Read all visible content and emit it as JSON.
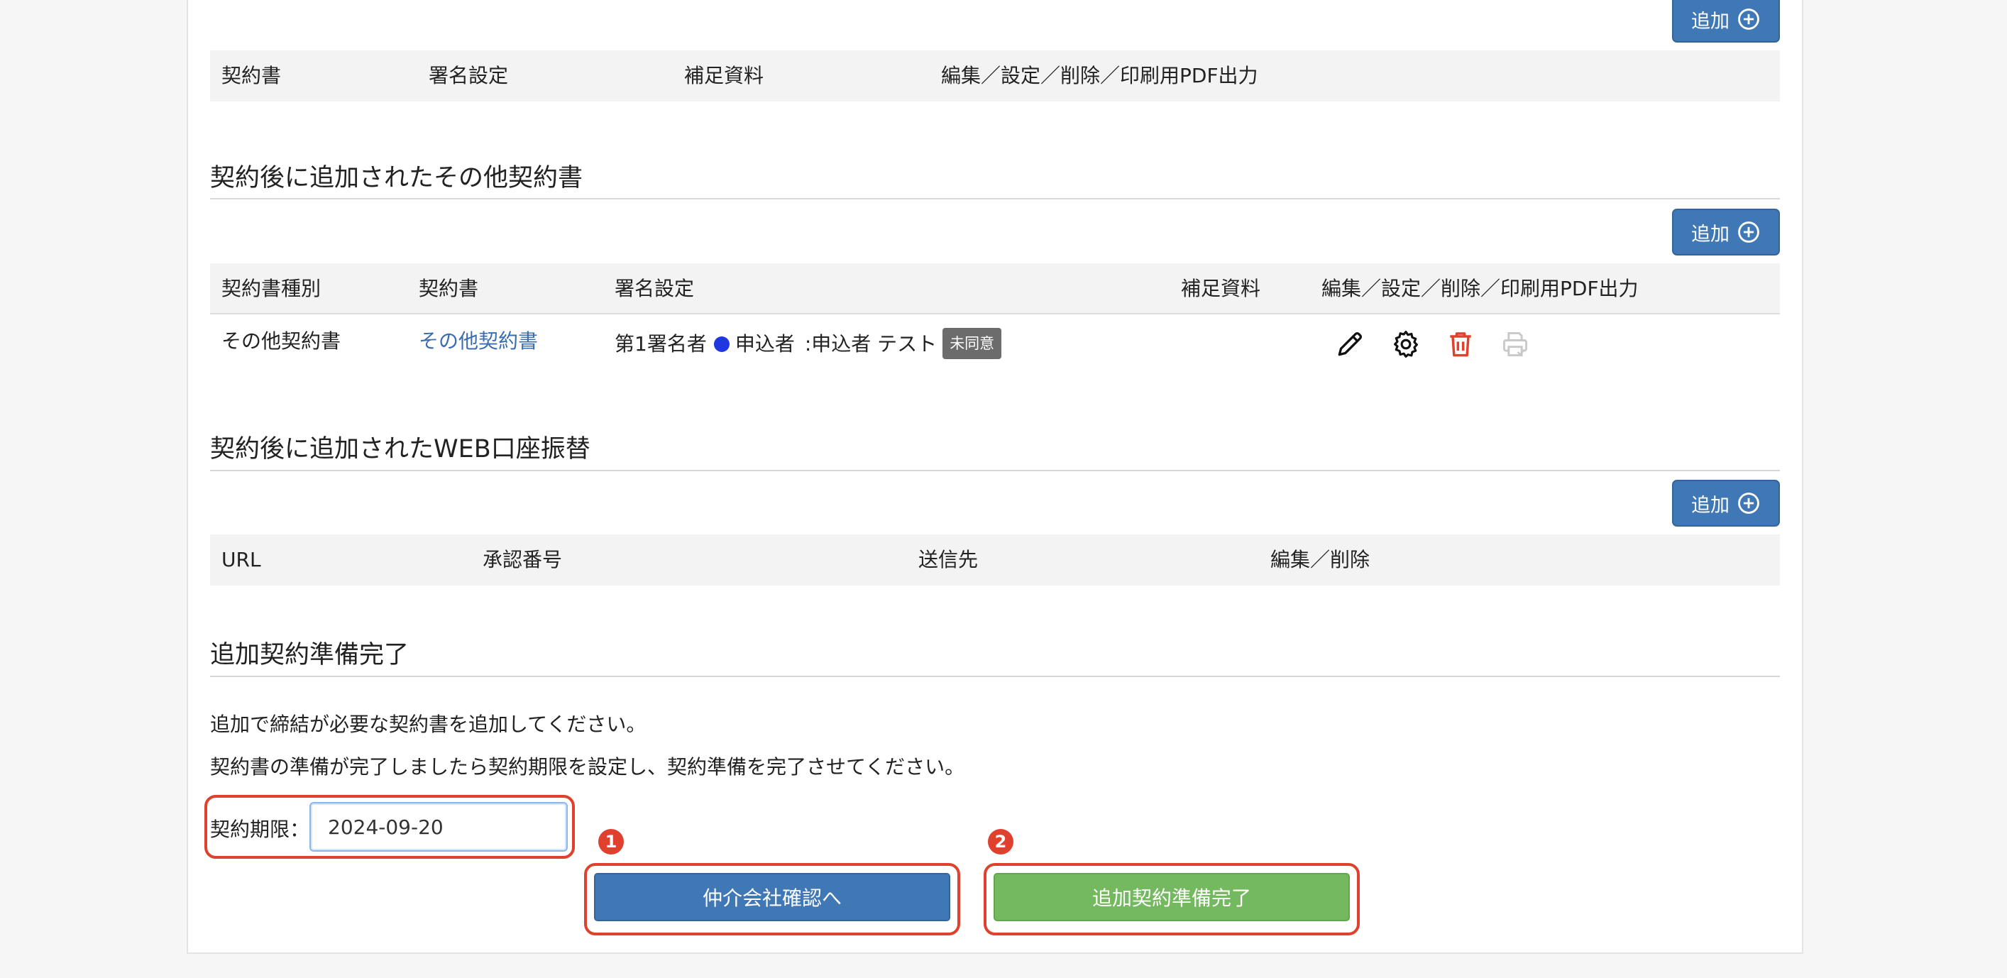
{
  "sections": {
    "contracts_table": {
      "add_button_label": "追加",
      "headers": [
        "契約書",
        "署名設定",
        "補足資料",
        "編集／設定／削除／印刷用PDF出力"
      ]
    },
    "other_contracts": {
      "title": "契約後に追加されたその他契約書",
      "add_button_label": "追加",
      "headers": [
        "契約書種別",
        "契約書",
        "署名設定",
        "補足資料",
        "編集／設定／削除／印刷用PDF出力"
      ],
      "rows": [
        {
          "type": "その他契約書",
          "contract": "その他契約書",
          "signer_prefix": "第1署名者",
          "signer_role": "申込者",
          "signer_name": ":申込者 テスト",
          "status_badge": "未同意"
        }
      ]
    },
    "web_transfer": {
      "title": "契約後に追加されたWEB口座振替",
      "add_button_label": "追加",
      "headers": [
        "URL",
        "承認番号",
        "送信先",
        "編集／削除"
      ]
    },
    "completion": {
      "title": "追加契約準備完了",
      "instruction_1": "追加で締結が必要な契約書を追加してください。",
      "instruction_2": "契約書の準備が完了しましたら契約期限を設定し、契約準備を完了させてください。",
      "deadline_label": "契約期限：",
      "deadline_value": "2024-09-20",
      "broker_button_label": "仲介会社確認へ",
      "complete_button_label": "追加契約準備完了",
      "marker_1": "1",
      "marker_2": "2"
    }
  },
  "colors": {
    "primary": "#4078b6",
    "success": "#74b95f",
    "danger": "#e0402e",
    "link": "#3a6cb0"
  },
  "icons": [
    "plus-circle-icon",
    "pencil-icon",
    "gear-icon",
    "trash-icon",
    "printer-icon"
  ]
}
